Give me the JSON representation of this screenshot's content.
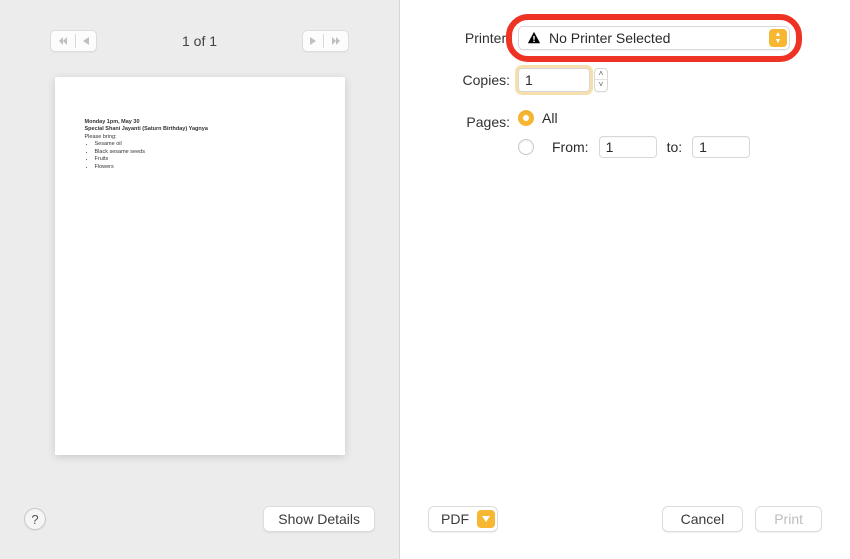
{
  "preview": {
    "page_counter": "1 of 1",
    "doc": {
      "line1": "Monday 1pm, May 30",
      "line2": "Special Shani Jayanti (Saturn Birthday) Yagnya",
      "line3": "Please bring:",
      "items": [
        "Sesame oil",
        "Black sesame seeds",
        "Fruits",
        "Flowers"
      ]
    }
  },
  "left_footer": {
    "help_label": "?",
    "show_details_label": "Show Details"
  },
  "form": {
    "printer_label": "Printer:",
    "printer_value": "No Printer Selected",
    "copies_label": "Copies:",
    "copies_value": "1",
    "pages_label": "Pages:",
    "pages_all_label": "All",
    "pages_from_label": "From:",
    "pages_from_value": "1",
    "pages_to_label": "to:",
    "pages_to_value": "1"
  },
  "right_footer": {
    "pdf_label": "PDF",
    "cancel_label": "Cancel",
    "print_label": "Print"
  }
}
